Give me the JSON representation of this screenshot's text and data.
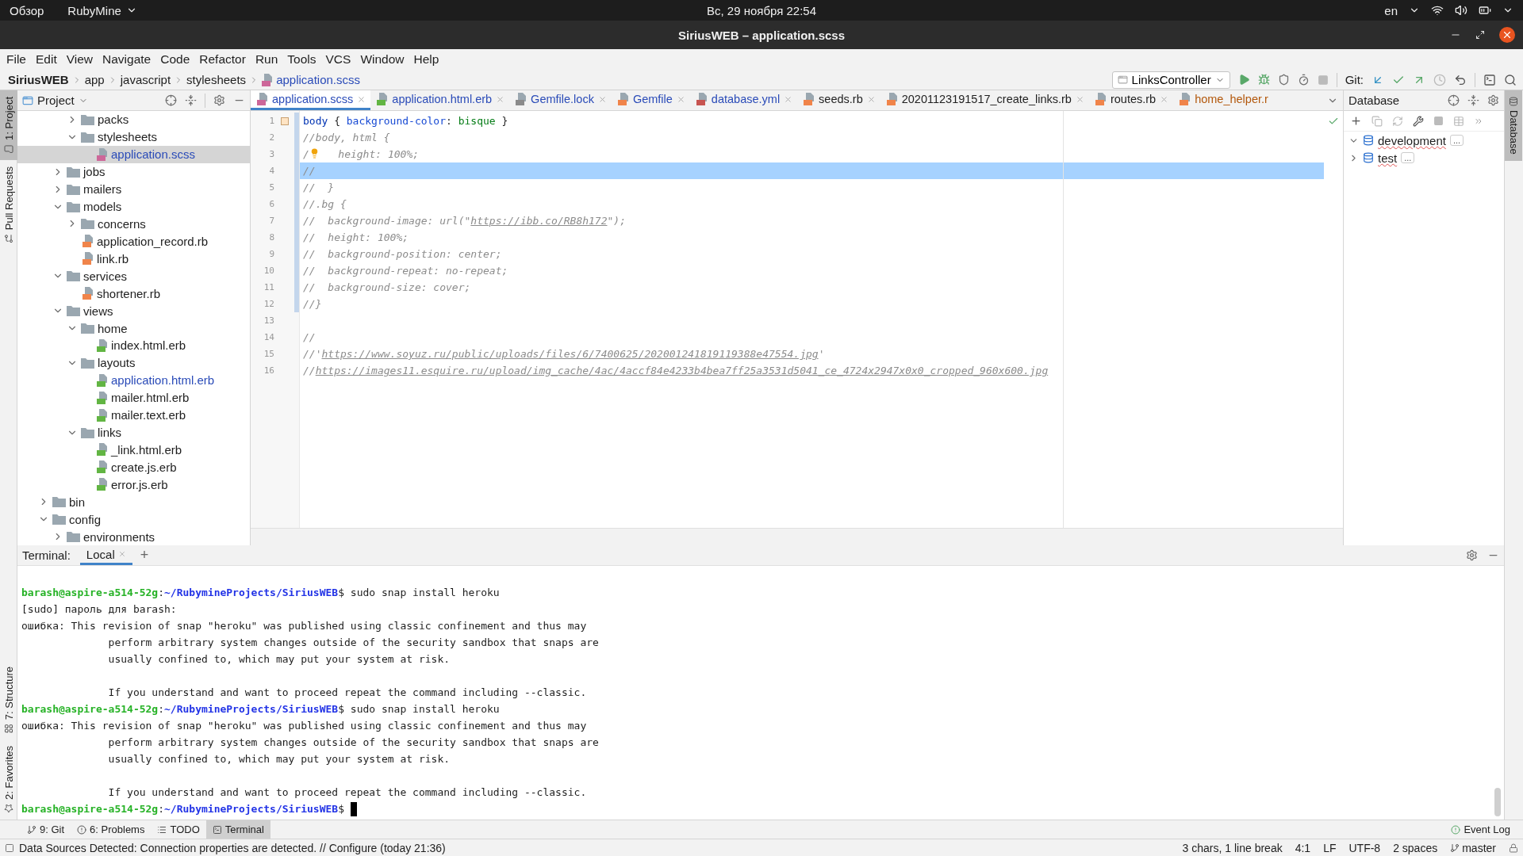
{
  "system_bar": {
    "activities": "Обзор",
    "app": "RubyMine",
    "clock": "Вс, 29 ноября  22:54",
    "language": "en"
  },
  "window": {
    "title": "SiriusWEB – application.scss"
  },
  "menu": [
    "File",
    "Edit",
    "View",
    "Navigate",
    "Code",
    "Refactor",
    "Run",
    "Tools",
    "VCS",
    "Window",
    "Help"
  ],
  "breadcrumb": [
    {
      "label": "SiriusWEB",
      "kind": "project"
    },
    {
      "label": "app",
      "kind": "folder"
    },
    {
      "label": "javascript",
      "kind": "folder"
    },
    {
      "label": "stylesheets",
      "kind": "folder"
    },
    {
      "label": "application.scss",
      "kind": "sass"
    }
  ],
  "run_config": "LinksController",
  "git_label": "Git:",
  "left_strip": [
    {
      "label": "1: Project",
      "selected": true
    },
    {
      "label": "Pull Requests",
      "selected": false
    }
  ],
  "left_strip_bottom": [
    {
      "label": "7: Structure",
      "selected": false
    },
    {
      "label": "2: Favorites",
      "selected": false
    }
  ],
  "right_strip": [
    {
      "label": "Database",
      "selected": true
    }
  ],
  "project": {
    "title": "Project",
    "tree": [
      {
        "children": [
          {
            "children": [
              {
                "label": "packs",
                "kind": "folder",
                "expanded": false,
                "selected": false,
                "modified": false
              },
              {
                "label": "stylesheets",
                "kind": "folder",
                "expanded": true,
                "selected": false,
                "modified": false,
                "children": [
                  {
                    "label": "application.scss",
                    "kind": "sass",
                    "selected": true,
                    "modified": true
                  }
                ]
              }
            ]
          },
          {
            "label": "jobs",
            "kind": "folder",
            "expanded": false,
            "selected": false,
            "modified": false
          },
          {
            "label": "mailers",
            "kind": "folder",
            "expanded": false,
            "selected": false,
            "modified": false
          },
          {
            "label": "models",
            "kind": "folder",
            "expanded": true,
            "selected": false,
            "modified": false,
            "children": [
              {
                "label": "concerns",
                "kind": "folder",
                "expanded": false,
                "selected": false,
                "modified": false
              },
              {
                "label": "application_record.rb",
                "kind": "ruby",
                "selected": false,
                "modified": false
              },
              {
                "label": "link.rb",
                "kind": "ruby",
                "selected": false,
                "modified": false
              }
            ]
          },
          {
            "label": "services",
            "kind": "folder",
            "expanded": true,
            "selected": false,
            "modified": false,
            "children": [
              {
                "label": "shortener.rb",
                "kind": "ruby",
                "selected": false,
                "modified": false
              }
            ]
          },
          {
            "label": "views",
            "kind": "folder",
            "expanded": true,
            "selected": false,
            "modified": false,
            "children": [
              {
                "label": "home",
                "kind": "folder",
                "expanded": true,
                "selected": false,
                "modified": false,
                "children": [
                  {
                    "label": "index.html.erb",
                    "kind": "erb",
                    "selected": false,
                    "modified": false
                  }
                ]
              },
              {
                "label": "layouts",
                "kind": "folder",
                "expanded": true,
                "selected": false,
                "modified": false,
                "children": [
                  {
                    "label": "application.html.erb",
                    "kind": "erb",
                    "selected": false,
                    "modified": true
                  },
                  {
                    "label": "mailer.html.erb",
                    "kind": "erb",
                    "selected": false,
                    "modified": false
                  },
                  {
                    "label": "mailer.text.erb",
                    "kind": "erb",
                    "selected": false,
                    "modified": false
                  }
                ]
              },
              {
                "label": "links",
                "kind": "folder",
                "expanded": true,
                "selected": false,
                "modified": false,
                "children": [
                  {
                    "label": "_link.html.erb",
                    "kind": "erb",
                    "selected": false,
                    "modified": false
                  },
                  {
                    "label": "create.js.erb",
                    "kind": "erb",
                    "selected": false,
                    "modified": false
                  },
                  {
                    "label": "error.js.erb",
                    "kind": "erb",
                    "selected": false,
                    "modified": false
                  }
                ]
              }
            ]
          }
        ]
      },
      {
        "label": "bin",
        "kind": "folder",
        "expanded": false,
        "selected": false,
        "modified": false
      },
      {
        "label": "config",
        "kind": "folder",
        "expanded": true,
        "selected": false,
        "modified": false,
        "children": [
          {
            "label": "environments",
            "kind": "folder",
            "expanded": false,
            "selected": false,
            "modified": false
          }
        ]
      }
    ]
  },
  "tabs": [
    {
      "label": "application.scss",
      "kind": "sass",
      "color": "#2a4bb8",
      "selected": true
    },
    {
      "label": "application.html.erb",
      "kind": "erb",
      "color": "#2a4bb8",
      "selected": false
    },
    {
      "label": "Gemfile.lock",
      "kind": "text",
      "color": "#2a4bb8",
      "selected": false
    },
    {
      "label": "Gemfile",
      "kind": "ruby",
      "color": "#2a4bb8",
      "selected": false
    },
    {
      "label": "database.yml",
      "kind": "yaml",
      "color": "#2a4bb8",
      "selected": false
    },
    {
      "label": "seeds.rb",
      "kind": "ruby",
      "color": "#1e1e1e",
      "selected": false
    },
    {
      "label": "20201123191517_create_links.rb",
      "kind": "ruby",
      "color": "#1e1e1e",
      "selected": false
    },
    {
      "label": "routes.rb",
      "kind": "ruby",
      "color": "#1e1e1e",
      "selected": false
    },
    {
      "label": "home_helper.r",
      "kind": "ruby",
      "color": "#b3580c",
      "selected": false
    }
  ],
  "editor": {
    "lines": [
      {
        "number": "1",
        "color": "#ffe4c4",
        "current": false,
        "segments": [
          {
            "text": "body",
            "kind": "selector"
          },
          {
            "text": " { ",
            "kind": "punct"
          },
          {
            "text": "background-color",
            "kind": "property"
          },
          {
            "text": ": ",
            "kind": "punct"
          },
          {
            "text": "bisque",
            "kind": "value"
          },
          {
            "text": " }",
            "kind": "punct"
          }
        ]
      },
      {
        "number": "2",
        "current": false,
        "segments": [
          {
            "text": "//body, html {",
            "kind": "comment"
          }
        ]
      },
      {
        "number": "3",
        "current": false,
        "segments": [
          {
            "text": "/",
            "kind": "comment"
          },
          {
            "kind": "bulb"
          },
          {
            "text": "   height: 100%;",
            "kind": "comment"
          }
        ]
      },
      {
        "number": "4",
        "current": true,
        "segments": [
          {
            "text": "//",
            "kind": "comment"
          }
        ]
      },
      {
        "number": "5",
        "current": false,
        "segments": [
          {
            "text": "//  }",
            "kind": "comment"
          }
        ]
      },
      {
        "number": "6",
        "current": false,
        "segments": [
          {
            "text": "//.bg {",
            "kind": "comment"
          }
        ]
      },
      {
        "number": "7",
        "current": false,
        "segments": [
          {
            "text": "//  background-image: url(\"",
            "kind": "comment"
          },
          {
            "text": "https://ibb.co/RB8h172",
            "kind": "link"
          },
          {
            "text": "\");",
            "kind": "comment"
          }
        ]
      },
      {
        "number": "8",
        "current": false,
        "segments": [
          {
            "text": "//  height: 100%;",
            "kind": "comment"
          }
        ]
      },
      {
        "number": "9",
        "current": false,
        "segments": [
          {
            "text": "//  background-position: center;",
            "kind": "comment"
          }
        ]
      },
      {
        "number": "10",
        "current": false,
        "segments": [
          {
            "text": "//  background-repeat: no-repeat;",
            "kind": "comment"
          }
        ]
      },
      {
        "number": "11",
        "current": false,
        "segments": [
          {
            "text": "//  background-size: cover;",
            "kind": "comment"
          }
        ]
      },
      {
        "number": "12",
        "current": false,
        "segments": [
          {
            "text": "//}",
            "kind": "comment"
          }
        ]
      },
      {
        "number": "13",
        "current": false
      },
      {
        "number": "14",
        "current": false,
        "segments": [
          {
            "text": "//",
            "kind": "comment"
          }
        ]
      },
      {
        "number": "15",
        "current": false,
        "segments": [
          {
            "text": "//'",
            "kind": "comment"
          },
          {
            "text": "https://www.soyuz.ru/public/uploads/files/6/7400625/202001241819119388e47554.jpg",
            "kind": "link"
          },
          {
            "text": "'",
            "kind": "comment"
          }
        ]
      },
      {
        "number": "16",
        "current": false,
        "segments": [
          {
            "text": "//",
            "kind": "comment"
          },
          {
            "text": "https://images11.esquire.ru/upload/img_cache/4ac/4accf84e4233b4bea7ff25a3531d5041_ce_4724x2947x0x0_cropped_960x600.jpg",
            "kind": "link"
          }
        ]
      }
    ]
  },
  "database": {
    "title": "Database",
    "items": [
      {
        "label": "development",
        "expanded": true,
        "badge": "..."
      },
      {
        "label": "test",
        "expanded": false,
        "badge": "..."
      }
    ]
  },
  "terminal": {
    "label": "Terminal:",
    "tabs": [
      {
        "label": "Local",
        "selected": true
      }
    ],
    "add": "+",
    "lines": [
      {
        "kind": "prompt",
        "user": "barash@aspire-a514-52g",
        "sep": ":",
        "path": "~/RubymineProjects/SiriusWEB",
        "command": "$ sudo snap install heroku"
      },
      {
        "kind": "output",
        "text": "[sudo] пароль для barash:"
      },
      {
        "kind": "output",
        "text": "ошибка: This revision of snap \"heroku\" was published using classic confinement and thus may"
      },
      {
        "kind": "output",
        "text": "              perform arbitrary system changes outside of the security sandbox that snaps are"
      },
      {
        "kind": "output",
        "text": "              usually confined to, which may put your system at risk."
      },
      {
        "kind": "blank"
      },
      {
        "kind": "output",
        "text": "              If you understand and want to proceed repeat the command including --classic."
      },
      {
        "kind": "prompt",
        "user": "barash@aspire-a514-52g",
        "sep": ":",
        "path": "~/RubymineProjects/SiriusWEB",
        "command": "$ sudo snap install heroku"
      },
      {
        "kind": "output",
        "text": "ошибка: This revision of snap \"heroku\" was published using classic confinement and thus may"
      },
      {
        "kind": "output",
        "text": "              perform arbitrary system changes outside of the security sandbox that snaps are"
      },
      {
        "kind": "output",
        "text": "              usually confined to, which may put your system at risk."
      },
      {
        "kind": "blank"
      },
      {
        "kind": "output",
        "text": "              If you understand and want to proceed repeat the command including --classic."
      },
      {
        "kind": "prompt",
        "user": "barash@aspire-a514-52g",
        "sep": ":",
        "path": "~/RubymineProjects/SiriusWEB",
        "command": "$ ",
        "cursor": true
      }
    ]
  },
  "tool_tabs": [
    {
      "label": "9: Git",
      "kind": "git",
      "selected": false
    },
    {
      "label": "6: Problems",
      "kind": "problems",
      "selected": false
    },
    {
      "label": "TODO",
      "kind": "todo",
      "selected": false
    },
    {
      "label": "Terminal",
      "kind": "terminal",
      "selected": true
    }
  ],
  "event_log": "Event Log",
  "status_bar": {
    "message": "Data Sources Detected: Connection properties are detected. // Configure (today 21:36)",
    "items": [
      "3 chars, 1 line break",
      "4:1",
      "LF",
      "UTF-8",
      "2 spaces"
    ],
    "branch": "master"
  }
}
